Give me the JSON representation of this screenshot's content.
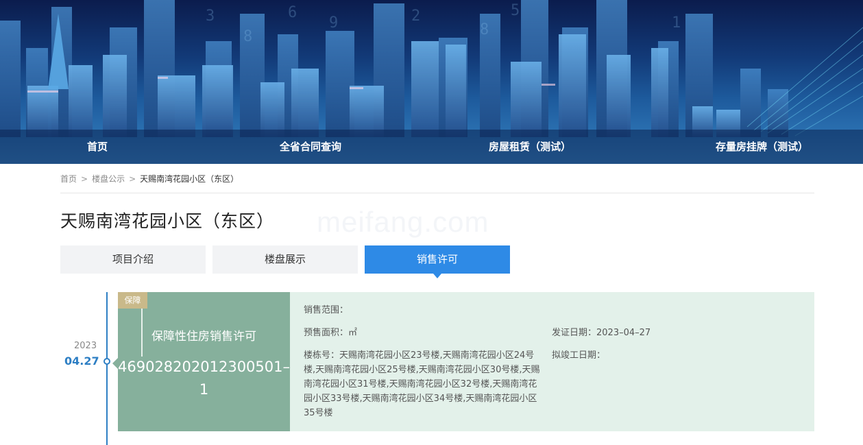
{
  "nav": {
    "items": [
      "首页",
      "全省合同查询",
      "房屋租赁（测试）",
      "存量房挂牌（测试）"
    ]
  },
  "breadcrumb": {
    "home": "首页",
    "section": "楼盘公示",
    "current": "天赐南湾花园小区（东区）",
    "sep": ">"
  },
  "page": {
    "title": "天赐南湾花园小区（东区）",
    "watermark": "meifang.com"
  },
  "tabs": [
    {
      "label": "项目介绍",
      "active": false
    },
    {
      "label": "楼盘展示",
      "active": false
    },
    {
      "label": "销售许可",
      "active": true
    }
  ],
  "timeline": {
    "year": "2023",
    "date": "04.27"
  },
  "permit": {
    "badge": "保障",
    "title": "保障性住房销售许可",
    "number": "4690282020123005​01–1",
    "sales_scope_label": "销售范围：",
    "sales_scope_value": "",
    "presale_area_label": "预售面积：",
    "presale_area_value": "㎡",
    "issue_date_label": "发证日期：",
    "issue_date_value": "2023–04–27",
    "buildings_label": "楼栋号：",
    "buildings_value": "天赐南湾花园小区23号楼,天赐南湾花园小区24号楼,天赐南湾花园小区25号楼,天赐南湾花园小区30号楼,天赐南湾花园小区31号楼,天赐南湾花园小区32号楼,天赐南湾花园小区33号楼,天赐南湾花园小区34号楼,天赐南湾花园小区35号楼",
    "completion_label": "拟竣工日期：",
    "completion_value": ""
  },
  "colors": {
    "accent": "#2e8ae6",
    "timeline": "#2e7fc4",
    "card_dark": "#86b09c",
    "card_light": "#e3f1ea",
    "badge": "#c9b98a"
  }
}
